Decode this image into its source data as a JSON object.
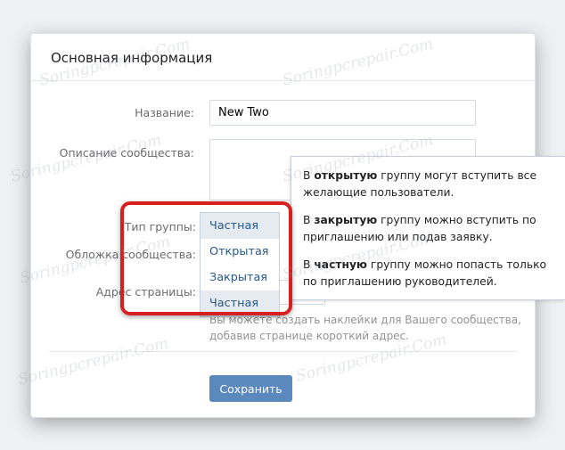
{
  "card": {
    "title": "Основная информация"
  },
  "form": {
    "name_label": "Название:",
    "name_value": "New Two",
    "description_label": "Описание сообщества:",
    "group_type_label": "Тип группы:",
    "cover_label": "Обложка сообщества:",
    "address_label": "Адрес страницы:",
    "address_hint_line1": "Вы можете создать наклейки для Вашего сообщества,",
    "address_hint_line2": "добавив странице короткий адрес.",
    "save_label": "Сохранить"
  },
  "dropdown": {
    "selected": "Частная",
    "options": [
      "Открытая",
      "Закрытая",
      "Частная"
    ]
  },
  "tooltip": {
    "p1_pre": "В ",
    "p1_bold": "открытую",
    "p1_post": " группу могут вступить все желающие пользователи.",
    "p2_pre": "В ",
    "p2_bold": "закрытую",
    "p2_post": " группу можно вступить по приглашению или подав заявку.",
    "p3_pre": "В ",
    "p3_bold": "частную",
    "p3_post": " группу можно попасть только по приглашению руководителей."
  },
  "watermark_text": "Soringpcrepair.Com",
  "colors": {
    "button_blue": "#5b88bd",
    "link_blue": "#2a5885",
    "highlight_red": "#d61f1f"
  }
}
